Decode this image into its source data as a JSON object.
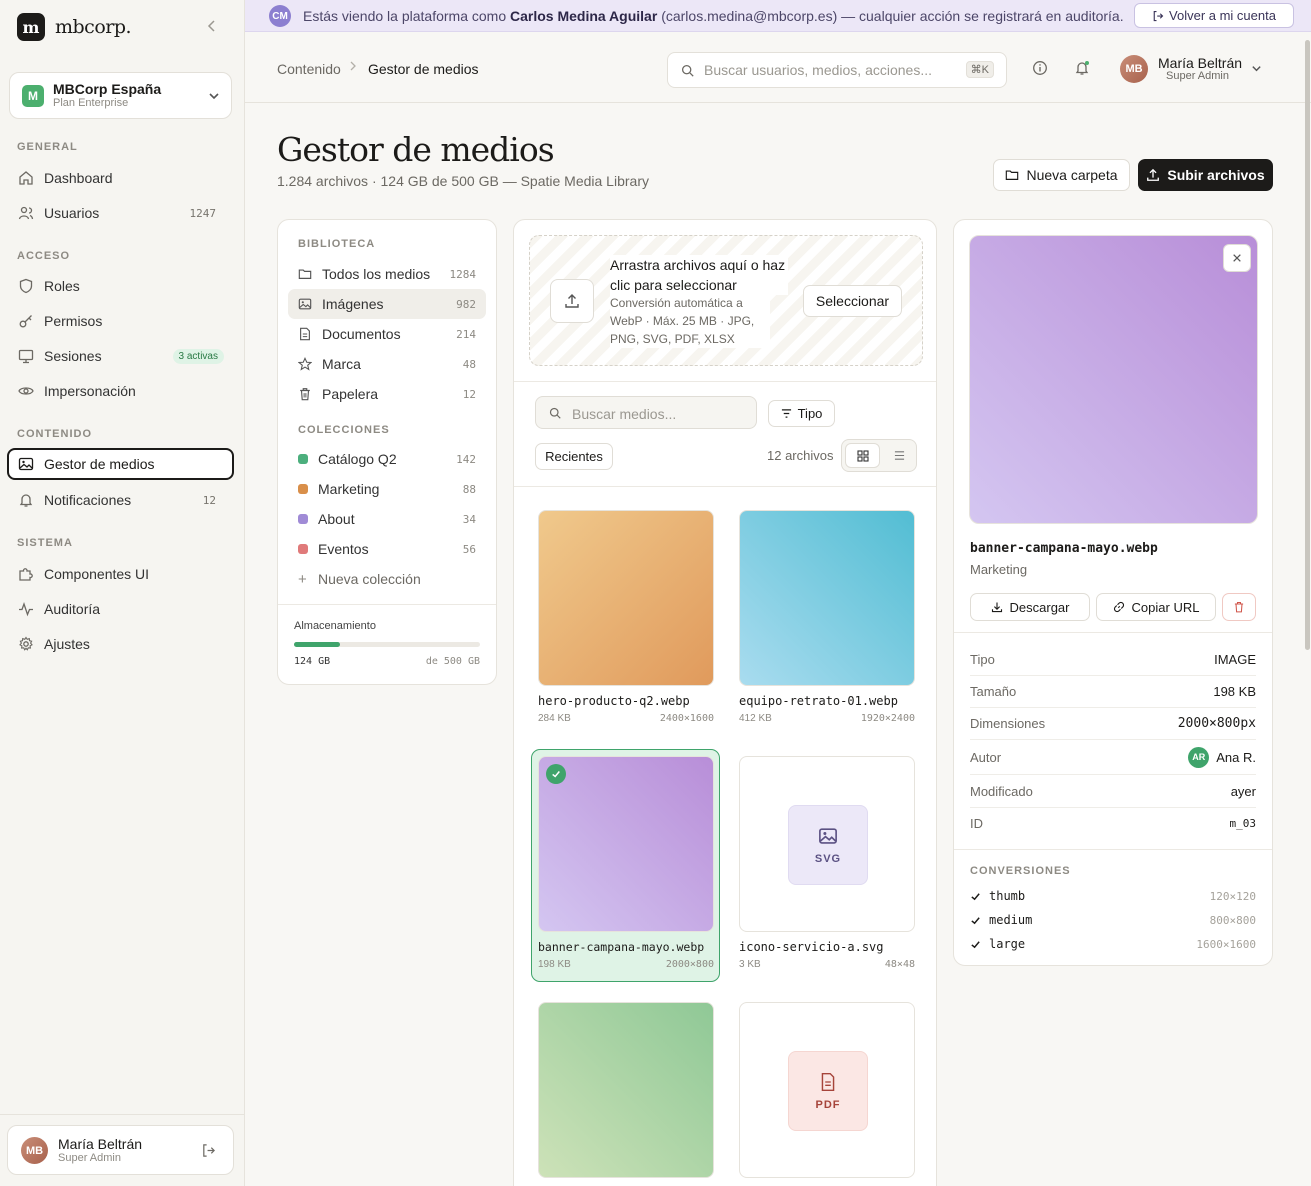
{
  "app": {
    "brand": "mbcorp."
  },
  "org": {
    "initial": "M",
    "name": "MBCorp España",
    "plan": "Plan Enterprise"
  },
  "sidebar": {
    "sections": {
      "general": "GENERAL",
      "acceso": "ACCESO",
      "contenido": "CONTENIDO",
      "sistema": "SISTEMA"
    },
    "items": [
      {
        "label": "Dashboard",
        "icon": "home-icon"
      },
      {
        "label": "Usuarios",
        "icon": "users-icon",
        "count": "1247"
      },
      {
        "label": "Roles",
        "icon": "shield-icon"
      },
      {
        "label": "Permisos",
        "icon": "key-icon"
      },
      {
        "label": "Sesiones",
        "icon": "monitor-icon",
        "badge": "3 activas"
      },
      {
        "label": "Impersonación",
        "icon": "eye-icon"
      },
      {
        "label": "Gestor de medios",
        "icon": "image-icon"
      },
      {
        "label": "Notificaciones",
        "icon": "bell-icon",
        "count": "12"
      },
      {
        "label": "Componentes UI",
        "icon": "puzzle-icon"
      },
      {
        "label": "Auditoría",
        "icon": "activity-icon"
      },
      {
        "label": "Ajustes",
        "icon": "gear-icon"
      }
    ]
  },
  "current_user": {
    "initials": "MB",
    "name": "María Beltrán",
    "role": "Super Admin"
  },
  "impersonation": {
    "avatar": "CM",
    "prefix": "Estás viendo la plataforma como",
    "name": "Carlos Medina Aguilar",
    "suffix": "(carlos.medina@mbcorp.es) — cualquier acción se registrará en auditoría.",
    "button": "Volver a mi cuenta"
  },
  "topbar": {
    "breadcrumb": [
      "Contenido",
      "Gestor de medios"
    ],
    "search_placeholder": "Buscar usuarios, medios, acciones...",
    "shortcut": "⌘K"
  },
  "page": {
    "title": "Gestor de medios",
    "subtitle": "1.284 archivos · 124 GB de 500 GB — Spatie Media Library",
    "new_folder": "Nueva carpeta",
    "upload": "Subir archivos"
  },
  "library": {
    "heading": "BIBLIOTECA",
    "items": [
      {
        "label": "Todos los medios",
        "count": "1284",
        "icon": "folder-icon"
      },
      {
        "label": "Imágenes",
        "count": "982",
        "icon": "image-icon"
      },
      {
        "label": "Documentos",
        "count": "214",
        "icon": "document-icon"
      },
      {
        "label": "Marca",
        "count": "48",
        "icon": "star-icon"
      },
      {
        "label": "Papelera",
        "count": "12",
        "icon": "trash-icon"
      }
    ],
    "collections_heading": "COLECCIONES",
    "collections": [
      {
        "label": "Catálogo Q2",
        "count": "142",
        "color": "#4caf7d"
      },
      {
        "label": "Marketing",
        "count": "88",
        "color": "#d98f4a"
      },
      {
        "label": "About",
        "count": "34",
        "color": "#a08bd6"
      },
      {
        "label": "Eventos",
        "count": "56",
        "color": "#e07a7a"
      }
    ],
    "new_collection": "Nueva colección",
    "storage": {
      "label": "Almacenamiento",
      "used": "124 GB",
      "total": "de 500 GB",
      "fraction": 0.248
    }
  },
  "upload": {
    "title": "Arrastra archivos aquí o haz clic para seleccionar",
    "desc": "Conversión automática a WebP · Máx. 25 MB · JPG, PNG, SVG, PDF, XLSX",
    "button": "Seleccionar"
  },
  "media": {
    "search_placeholder": "Buscar medios...",
    "type_filter": "Tipo",
    "sort": "Recientes",
    "count": "12 archivos",
    "files": [
      {
        "name": "hero-producto-q2.webp",
        "size": "284 KB",
        "dims": "2400×1600",
        "gradient": [
          "#f0c98c",
          "#e09a5c"
        ]
      },
      {
        "name": "equipo-retrato-01.webp",
        "size": "412 KB",
        "dims": "1920×2400",
        "gradient": [
          "#a9dcef",
          "#52bdd3"
        ]
      },
      {
        "name": "banner-campana-mayo.webp",
        "size": "198 KB",
        "dims": "2000×800",
        "gradient": [
          "#d4c6f1",
          "#b88ed8"
        ]
      },
      {
        "name": "icono-servicio-a.svg",
        "size": "3 KB",
        "dims": "48×48",
        "badge": "SVG"
      },
      {
        "name": "",
        "gradient": [
          "#cde2b8",
          "#8fc896"
        ]
      },
      {
        "name": "",
        "badge": "PDF"
      }
    ]
  },
  "details": {
    "filename": "banner-campana-mayo.webp",
    "collection": "Marketing",
    "download": "Descargar",
    "copy_url": "Copiar URL",
    "props": [
      {
        "key": "Tipo",
        "value": "IMAGE"
      },
      {
        "key": "Tamaño",
        "value": "198 KB"
      },
      {
        "key": "Dimensiones",
        "value": "2000×800px"
      },
      {
        "key": "Autor",
        "value": "Ana R.",
        "avatar": "AR"
      },
      {
        "key": "Modificado",
        "value": "ayer"
      },
      {
        "key": "ID",
        "value": "m_03"
      }
    ],
    "conversions_heading": "CONVERSIONES",
    "conversions": [
      {
        "name": "thumb",
        "size": "120×120"
      },
      {
        "name": "medium",
        "size": "800×800"
      },
      {
        "name": "large",
        "size": "1600×1600"
      }
    ]
  }
}
